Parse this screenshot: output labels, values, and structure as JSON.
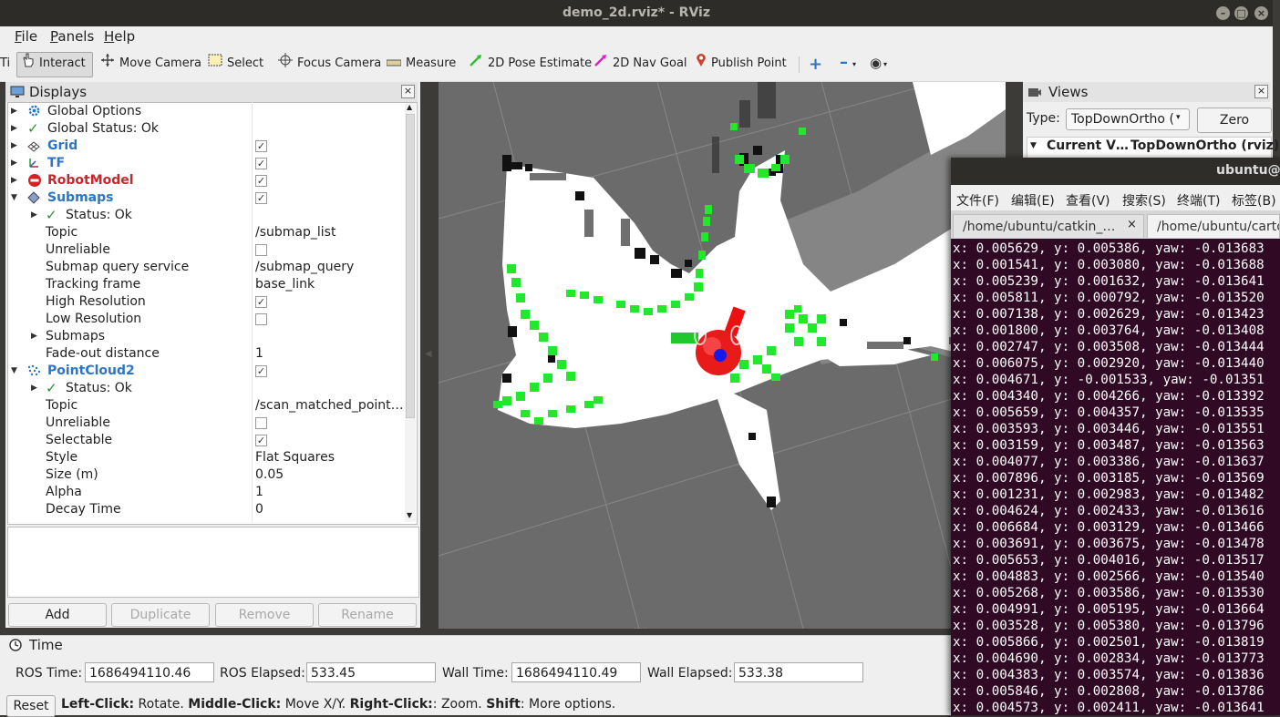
{
  "window": {
    "title": "demo_2d.rviz* - RViz"
  },
  "menubar": {
    "file": "File",
    "panels": "Panels",
    "help": "Help",
    "file_u": "F",
    "file_rest": "ile",
    "panels_u": "P",
    "panels_rest": "anels",
    "help_u": "H",
    "help_rest": "elp"
  },
  "toolbar": {
    "left_clip": "Ti",
    "interact": "Interact",
    "move_camera": "Move Camera",
    "select": "Select",
    "focus_camera": "Focus Camera",
    "measure": "Measure",
    "pose_estimate": "2D Pose Estimate",
    "nav_goal": "2D Nav Goal",
    "publish_point": "Publish Point"
  },
  "displays": {
    "title": "Displays",
    "rows": [
      {
        "name": "Global Options",
        "value": ""
      },
      {
        "name": "Global Status: Ok",
        "value": ""
      },
      {
        "name": "Grid",
        "value": ""
      },
      {
        "name": "TF",
        "value": ""
      },
      {
        "name": "RobotModel",
        "value": ""
      },
      {
        "name": "Submaps",
        "value": ""
      },
      {
        "name": "Status: Ok",
        "value": ""
      },
      {
        "name": "Topic",
        "value": "/submap_list"
      },
      {
        "name": "Unreliable",
        "value": ""
      },
      {
        "name": "Submap query service",
        "value": "/submap_query"
      },
      {
        "name": "Tracking frame",
        "value": "base_link"
      },
      {
        "name": "High Resolution",
        "value": ""
      },
      {
        "name": "Low Resolution",
        "value": ""
      },
      {
        "name": "Submaps",
        "value": ""
      },
      {
        "name": "Fade-out distance",
        "value": "1"
      },
      {
        "name": "PointCloud2",
        "value": ""
      },
      {
        "name": "Status: Ok",
        "value": ""
      },
      {
        "name": "Topic",
        "value": "/scan_matched_point…"
      },
      {
        "name": "Unreliable",
        "value": ""
      },
      {
        "name": "Selectable",
        "value": ""
      },
      {
        "name": "Style",
        "value": "Flat Squares"
      },
      {
        "name": "Size (m)",
        "value": "0.05"
      },
      {
        "name": "Alpha",
        "value": "1"
      },
      {
        "name": "Decay Time",
        "value": "0"
      }
    ],
    "buttons": {
      "add": "Add",
      "duplicate": "Duplicate",
      "remove": "Remove",
      "rename": "Rename"
    }
  },
  "views": {
    "title": "Views",
    "type_label": "Type:",
    "type_value": "TopDownOrtho (",
    "zero": "Zero",
    "current_label": "Current V…",
    "current_value": "TopDownOrtho (rviz)"
  },
  "time": {
    "title": "Time",
    "ros_time_label": "ROS Time:",
    "ros_time": "1686494110.46",
    "ros_elapsed_label": "ROS Elapsed:",
    "ros_elapsed": "533.45",
    "wall_time_label": "Wall Time:",
    "wall_time": "1686494110.49",
    "wall_elapsed_label": "Wall Elapsed:",
    "wall_elapsed": "533.38"
  },
  "status": {
    "reset": "Reset",
    "left_click": "Left-Click:",
    "left_click_text": " Rotate. ",
    "middle_click": "Middle-Click:",
    "middle_click_text": " Move X/Y. ",
    "right_click": "Right-Click:",
    "right_click_text": ": Zoom. ",
    "shift": "Shift",
    "shift_text": ": More options."
  },
  "terminal": {
    "title": "ubuntu@u",
    "menu": [
      "文件(F)",
      "编辑(E)",
      "查看(V)",
      "搜索(S)",
      "终端(T)",
      "标签(B)"
    ],
    "tabs": [
      "/home/ubuntu/catkin_…",
      "/home/ubuntu/carto"
    ],
    "lines": [
      "x: 0.005629, y: 0.005386, yaw: -0.013683",
      "x: 0.001541, y: 0.003080, yaw: -0.013688",
      "x: 0.005239, y: 0.001632, yaw: -0.013641",
      "x: 0.005811, y: 0.000792, yaw: -0.013520",
      "x: 0.007138, y: 0.002629, yaw: -0.013423",
      "x: 0.001800, y: 0.003764, yaw: -0.013408",
      "x: 0.002747, y: 0.003508, yaw: -0.013444",
      "x: 0.006075, y: 0.002920, yaw: -0.013440",
      "x: 0.004671, y: -0.001533, yaw: -0.01351",
      "x: 0.004340, y: 0.004266, yaw: -0.013392",
      "x: 0.005659, y: 0.004357, yaw: -0.013535",
      "x: 0.003593, y: 0.003446, yaw: -0.013551",
      "x: 0.003159, y: 0.003487, yaw: -0.013563",
      "x: 0.004077, y: 0.003386, yaw: -0.013637",
      "x: 0.007896, y: 0.003185, yaw: -0.013569",
      "x: 0.001231, y: 0.002983, yaw: -0.013482",
      "x: 0.004624, y: 0.002433, yaw: -0.013616",
      "x: 0.006684, y: 0.003129, yaw: -0.013466",
      "x: 0.003691, y: 0.003675, yaw: -0.013478",
      "x: 0.005653, y: 0.004016, yaw: -0.013517",
      "x: 0.004883, y: 0.002566, yaw: -0.013540",
      "x: 0.005268, y: 0.003586, yaw: -0.013530",
      "x: 0.004991, y: 0.005195, yaw: -0.013664",
      "x: 0.003528, y: 0.005380, yaw: -0.013796",
      "x: 0.005866, y: 0.002501, yaw: -0.013819",
      "x: 0.004690, y: 0.002834, yaw: -0.013773",
      "x: 0.004383, y: 0.003574, yaw: -0.013836",
      "x: 0.005846, y: 0.002808, yaw: -0.013786",
      "x: 0.004573, y: 0.002411, yaw: -0.013641"
    ]
  },
  "colors": {
    "accent_blue": "#2b76c8",
    "error_red": "#c8262d",
    "terminal_bg": "#300a24",
    "laser_green": "#22e82b"
  }
}
